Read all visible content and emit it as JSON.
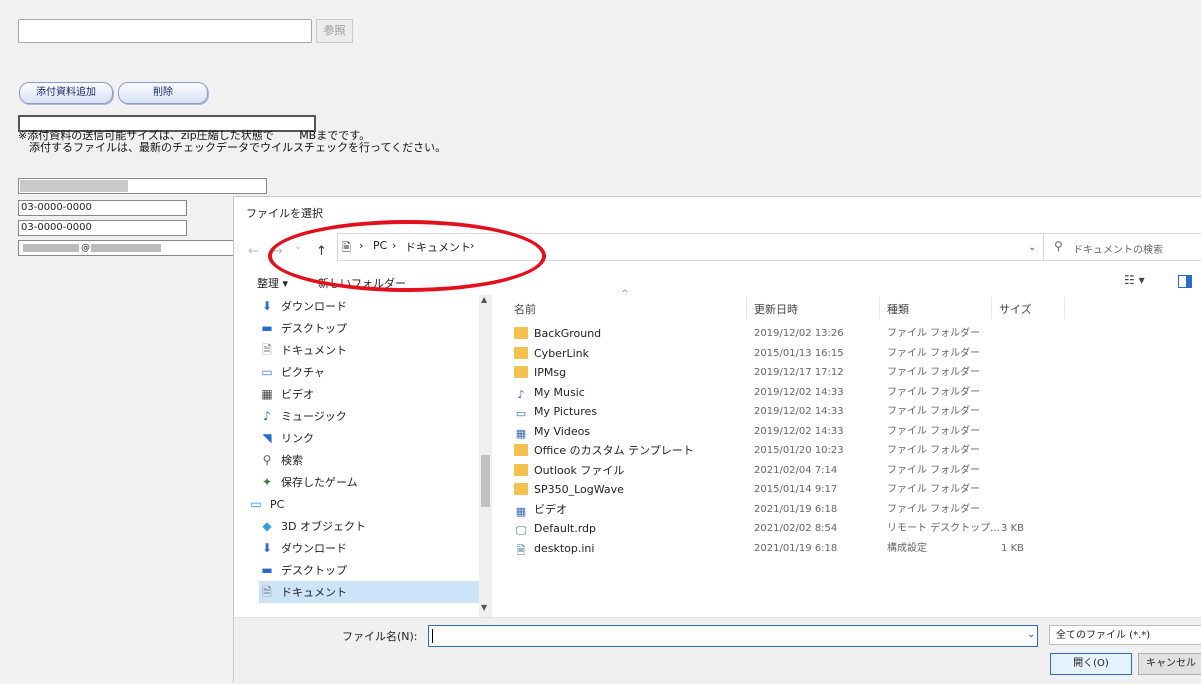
{
  "form": {
    "browse_label": "参照",
    "add_attachment_label": "添付資料追加",
    "delete_label": "削除",
    "note_line1": "※添付資料の送信可能サイズは、zip圧縮した状態で　 　MBまでです。",
    "note_line2": "　添付するファイルは、最新のチェックデータでウイルスチェックを行ってください。",
    "tel": "03-0000-0000",
    "fax": "03-0000-0000",
    "email_at": "@"
  },
  "dialog": {
    "title": "ファイルを選択",
    "nav": {
      "back": "←",
      "forward": "→",
      "recent": "⌄",
      "up": "↑"
    },
    "breadcrumb": [
      "PC",
      "ドキュメント"
    ],
    "search_placeholder": "ドキュメントの検索",
    "toolbar": {
      "organize": "整理 ▾",
      "new_folder": "新しいフォルダー"
    },
    "tree": [
      {
        "label": "ダウンロード",
        "icon": "download-icon"
      },
      {
        "label": "デスクトップ",
        "icon": "desktop-icon"
      },
      {
        "label": "ドキュメント",
        "icon": "document-icon"
      },
      {
        "label": "ピクチャ",
        "icon": "pictures-icon"
      },
      {
        "label": "ビデオ",
        "icon": "video-icon"
      },
      {
        "label": "ミュージック",
        "icon": "music-icon"
      },
      {
        "label": "リンク",
        "icon": "link-icon"
      },
      {
        "label": "検索",
        "icon": "search-icon"
      },
      {
        "label": "保存したゲーム",
        "icon": "games-icon"
      },
      {
        "label": "PC",
        "icon": "pc-icon"
      },
      {
        "label": "3D オブジェクト",
        "icon": "3d-objects-icon"
      },
      {
        "label": "ダウンロード",
        "icon": "download-icon"
      },
      {
        "label": "デスクトップ",
        "icon": "desktop-icon"
      },
      {
        "label": "ドキュメント",
        "icon": "document-icon",
        "selected": true
      }
    ],
    "columns": {
      "name": "名前",
      "modified": "更新日時",
      "type": "種類",
      "size": "サイズ"
    },
    "files": [
      {
        "name": "BackGround",
        "date": "2019/12/02 13:26",
        "type": "ファイル フォルダー",
        "size": "",
        "icon": "folder"
      },
      {
        "name": "CyberLink",
        "date": "2015/01/13 16:15",
        "type": "ファイル フォルダー",
        "size": "",
        "icon": "folder"
      },
      {
        "name": "IPMsg",
        "date": "2019/12/17 17:12",
        "type": "ファイル フォルダー",
        "size": "",
        "icon": "folder"
      },
      {
        "name": "My Music",
        "date": "2019/12/02 14:33",
        "type": "ファイル フォルダー",
        "size": "",
        "icon": "music"
      },
      {
        "name": "My Pictures",
        "date": "2019/12/02 14:33",
        "type": "ファイル フォルダー",
        "size": "",
        "icon": "pictures"
      },
      {
        "name": "My Videos",
        "date": "2019/12/02 14:33",
        "type": "ファイル フォルダー",
        "size": "",
        "icon": "video"
      },
      {
        "name": "Office のカスタム テンプレート",
        "date": "2015/01/20 10:23",
        "type": "ファイル フォルダー",
        "size": "",
        "icon": "folder"
      },
      {
        "name": "Outlook ファイル",
        "date": "2021/02/04 7:14",
        "type": "ファイル フォルダー",
        "size": "",
        "icon": "folder"
      },
      {
        "name": "SP350_LogWave",
        "date": "2015/01/14 9:17",
        "type": "ファイル フォルダー",
        "size": "",
        "icon": "folder"
      },
      {
        "name": "ビデオ",
        "date": "2021/01/19 6:18",
        "type": "ファイル フォルダー",
        "size": "",
        "icon": "video"
      },
      {
        "name": "Default.rdp",
        "date": "2021/02/02 8:54",
        "type": "リモート デスクトップ...",
        "size": "3 KB",
        "icon": "rdp"
      },
      {
        "name": "desktop.ini",
        "date": "2021/01/19 6:18",
        "type": "構成設定",
        "size": "1 KB",
        "icon": "ini"
      }
    ],
    "filename_label": "ファイル名(N):",
    "filename_value": "",
    "filter": "全てのファイル (*.*)",
    "open_label": "開く(O)",
    "cancel_label": "キャンセル"
  },
  "colors": {
    "accent": "#2c6bc7",
    "highlight_ring": "#e2101b",
    "folder": "#f2c14e"
  }
}
